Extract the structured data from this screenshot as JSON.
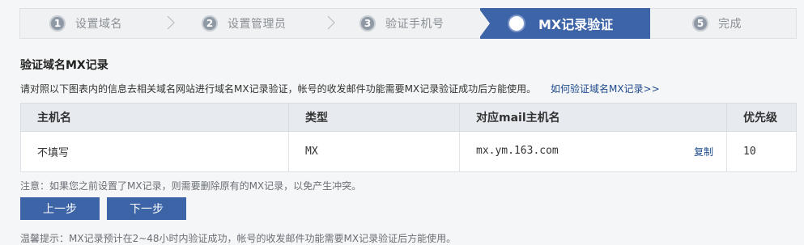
{
  "steps": [
    {
      "num": "1",
      "label": "设置域名"
    },
    {
      "num": "2",
      "label": "设置管理员"
    },
    {
      "num": "3",
      "label": "验证手机号"
    },
    {
      "num": "4",
      "label": "MX记录验证"
    },
    {
      "num": "5",
      "label": "完成"
    }
  ],
  "section_title": "验证域名MX记录",
  "description": "请对照以下图表内的信息去相关域名网站进行域名MX记录验证，帐号的收发邮件功能需要MX记录验证成功后方能使用。",
  "help_link": "如何验证域名MX记录>>",
  "table": {
    "headers": [
      "主机名",
      "类型",
      "对应mail主机名",
      "优先级"
    ],
    "row": {
      "host": "不填写",
      "type": "MX",
      "mail_host": "mx.ym.163.com",
      "copy": "复制",
      "priority": "10"
    }
  },
  "note": "注意：如果您之前设置了MX记录，则需要删除原有的MX记录，以免产生冲突。",
  "buttons": {
    "prev": "上一步",
    "next": "下一步"
  },
  "tip": "温馨提示：MX记录预计在2~48小时内验证成功，帐号的收发邮件功能需要MX记录验证后方能使用。"
}
